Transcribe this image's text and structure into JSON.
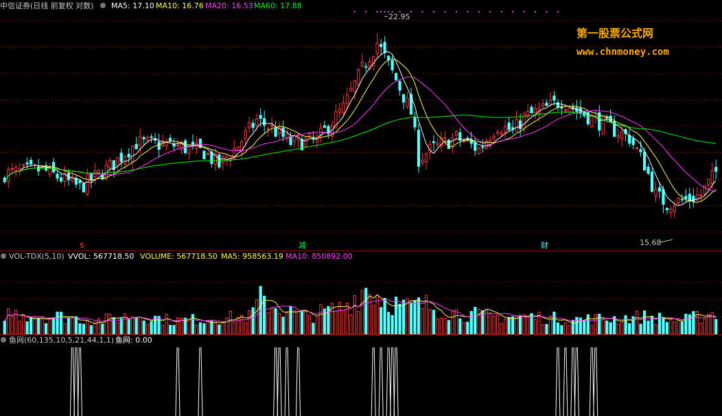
{
  "colors": {
    "up": "#ff3b3b",
    "down": "#54ffff",
    "ma5": "#ffffff",
    "ma10": "#ffff55",
    "ma20": "#ff40ff",
    "ma60": "#00ff00",
    "grid": "#7a0000",
    "divider": "#aa0000",
    "watermark": "#ffaa00",
    "text": "#c8c8c8"
  },
  "main_panel": {
    "title": "中信证券(日线 前复权 对数)",
    "ma5_label": "MA5: 17.10",
    "ma10_label": "MA10: 16.76",
    "ma20_label": "MA20: 16.53",
    "ma60_label": "MA60: 17.88",
    "high_label": "22.95",
    "low_label": "15.68",
    "events": [
      "$",
      "减",
      "财"
    ]
  },
  "volume_panel": {
    "name_label": "VOL-TDX(5,10)",
    "vvol_label": "VVOL: 567718.50",
    "volume_label": "VOLUME: 567718.50",
    "ma5_label": "MA5: 958563.19",
    "ma10_label": "MA10: 850892.00"
  },
  "indicator_panel": {
    "title": "鱼网(60,135,10,5,21,44,1,1)",
    "value_label": "鱼网: 0.00"
  },
  "watermark": {
    "line1": "第一股票公式网",
    "line2": "www.chnmoney.com"
  },
  "chart_data": {
    "type": "candlestick",
    "price_axis": "log",
    "ylim": [
      14.8,
      24.0
    ],
    "bars": 190,
    "highest": 22.95,
    "lowest": 15.68,
    "last_ma": {
      "ma5": 17.1,
      "ma10": 16.76,
      "ma20": 16.53,
      "ma60": 17.88
    },
    "close_anchors": [
      [
        0,
        17.05
      ],
      [
        10,
        17.2
      ],
      [
        20,
        16.55
      ],
      [
        28,
        17.3
      ],
      [
        35,
        18.2
      ],
      [
        45,
        18.1
      ],
      [
        53,
        17.85
      ],
      [
        57,
        17.35
      ],
      [
        62,
        18.1
      ],
      [
        67,
        19.1
      ],
      [
        71,
        18.75
      ],
      [
        76,
        18.2
      ],
      [
        83,
        18.3
      ],
      [
        90,
        19.6
      ],
      [
        96,
        21.6
      ],
      [
        99,
        22.5
      ],
      [
        104,
        20.8
      ],
      [
        108,
        19.4
      ],
      [
        110,
        17.6
      ],
      [
        114,
        18.0
      ],
      [
        120,
        18.4
      ],
      [
        126,
        17.95
      ],
      [
        131,
        18.9
      ],
      [
        135,
        18.65
      ],
      [
        138,
        19.2
      ],
      [
        144,
        19.6
      ],
      [
        148,
        19.9
      ],
      [
        152,
        19.5
      ],
      [
        157,
        19.1
      ],
      [
        162,
        18.7
      ],
      [
        166,
        18.4
      ],
      [
        170,
        17.4
      ],
      [
        173,
        16.3
      ],
      [
        176,
        16.0
      ],
      [
        180,
        16.1
      ],
      [
        185,
        16.3
      ],
      [
        189,
        17.1
      ]
    ],
    "volume_anchors": [
      [
        0,
        0.55
      ],
      [
        15,
        0.45
      ],
      [
        25,
        0.35
      ],
      [
        35,
        0.5
      ],
      [
        45,
        0.35
      ],
      [
        55,
        0.4
      ],
      [
        65,
        0.45
      ],
      [
        68,
        0.9
      ],
      [
        72,
        0.7
      ],
      [
        80,
        0.45
      ],
      [
        90,
        0.7
      ],
      [
        96,
        1.2
      ],
      [
        100,
        0.95
      ],
      [
        106,
        0.7
      ],
      [
        112,
        0.75
      ],
      [
        120,
        0.55
      ],
      [
        130,
        0.45
      ],
      [
        140,
        0.45
      ],
      [
        150,
        0.38
      ],
      [
        160,
        0.4
      ],
      [
        170,
        0.45
      ],
      [
        180,
        0.35
      ],
      [
        189,
        0.57
      ]
    ],
    "signal_bars": [
      [
        18,
        19,
        20
      ],
      [
        46
      ],
      [
        52
      ],
      [
        72,
        73
      ],
      [
        75
      ],
      [
        78
      ],
      [
        98
      ],
      [
        100
      ],
      [
        102
      ],
      [
        103
      ],
      [
        104
      ],
      [
        147
      ],
      [
        149
      ],
      [
        151
      ],
      [
        152
      ],
      [
        156
      ],
      [
        157
      ]
    ]
  }
}
